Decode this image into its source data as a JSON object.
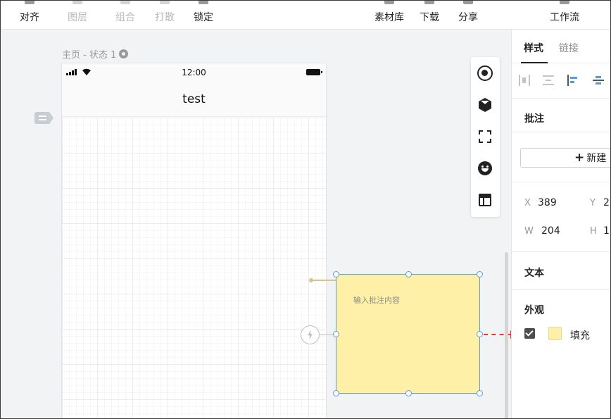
{
  "toolbar": {
    "items": [
      {
        "label": "对齐",
        "state": "active"
      },
      {
        "label": "图层",
        "state": "disabled"
      },
      {
        "label": "组合",
        "state": "disabled"
      },
      {
        "label": "打散",
        "state": "disabled"
      },
      {
        "label": "锁定",
        "state": "active"
      },
      {
        "label": "素材库",
        "state": "active"
      },
      {
        "label": "下载",
        "state": "active"
      },
      {
        "label": "分享",
        "state": "active"
      },
      {
        "label": "工作流",
        "state": "active"
      }
    ]
  },
  "canvas": {
    "page_label": "主页 - 状态 1",
    "phone": {
      "time": "12:00",
      "title": "test"
    },
    "note": {
      "placeholder": "输入批注内容",
      "fill_color": "#fff0a8",
      "border_color": "#5b9bd5"
    }
  },
  "tool_strip": {
    "icons": [
      "target-icon",
      "cube-icon",
      "scan-icon",
      "smile-icon",
      "layout-icon"
    ]
  },
  "panel": {
    "tabs": [
      {
        "label": "样式",
        "active": true
      },
      {
        "label": "链接",
        "active": false
      }
    ],
    "annotation_title": "批注",
    "new_button_label": "新建",
    "x_label": "X",
    "x_value": "389",
    "y_label": "Y",
    "y_value": "2",
    "w_label": "W",
    "w_value": "204",
    "h_label": "H",
    "h_value": "1",
    "text_title": "文本",
    "appearance_title": "外观",
    "fill_label": "填充",
    "fill_checked": true,
    "fill_color": "#fff0a8"
  },
  "colors": {
    "accent": "#5b9bd5",
    "arrow": "#e83a2f"
  }
}
